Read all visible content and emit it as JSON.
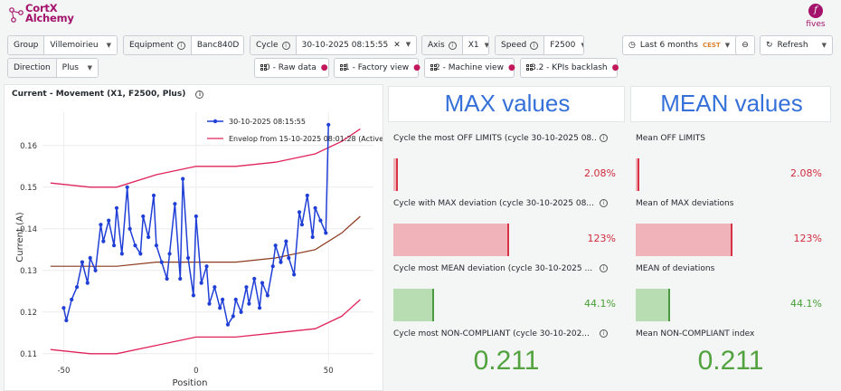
{
  "brand": {
    "line1": "CortX",
    "line2": "Alchemy",
    "right_logo": "fives"
  },
  "filters": {
    "group": {
      "label": "Group",
      "value": "Villemoirieu"
    },
    "equipment": {
      "label": "Equipment",
      "value": "Banc840D"
    },
    "cycle": {
      "label": "Cycle",
      "value": "30-10-2025 08:15:55"
    },
    "axis": {
      "label": "Axis",
      "value": "X1"
    },
    "speed": {
      "label": "Speed",
      "value": "F2500"
    },
    "direction": {
      "label": "Direction",
      "value": "Plus"
    }
  },
  "time_range": {
    "label": "Last 6 months",
    "tz": "CEST"
  },
  "refresh_label": "Refresh",
  "view_links": [
    "0 - Raw data",
    "1 - Factory view",
    "2 - Machine view",
    "3.2 - KPIs backlash"
  ],
  "chart_panel": {
    "title": "Current - Movement (X1, F2500, Plus)"
  },
  "chart_data": {
    "type": "line",
    "xlabel": "Position",
    "ylabel": "Current (A)",
    "xlim": [
      -58,
      67
    ],
    "ylim": [
      0.108,
      0.168
    ],
    "xticks": [
      -50,
      0,
      50
    ],
    "yticks": [
      0.11,
      0.12,
      0.13,
      0.14,
      0.15,
      0.16
    ],
    "legend_placement": "top-right",
    "series": [
      {
        "name": "30-10-2025 08:15:55",
        "color": "#1f3fd6",
        "style": "line+markers",
        "x": [
          -50,
          -49,
          -47,
          -45,
          -43,
          -41,
          -40,
          -38,
          -36,
          -35,
          -33,
          -31,
          -30,
          -28,
          -26,
          -25,
          -23,
          -21,
          -20,
          -18,
          -16,
          -15,
          -13,
          -11,
          -10,
          -8,
          -6,
          -5,
          -3,
          -1,
          0,
          2,
          4,
          5,
          7,
          9,
          10,
          12,
          14,
          15,
          17,
          19,
          20,
          22,
          24,
          25,
          27,
          29,
          30,
          32,
          34,
          35,
          37,
          39,
          40,
          42,
          44,
          45,
          47,
          49,
          50
        ],
        "y": [
          0.121,
          0.118,
          0.123,
          0.126,
          0.132,
          0.127,
          0.133,
          0.13,
          0.141,
          0.137,
          0.142,
          0.136,
          0.145,
          0.134,
          0.15,
          0.14,
          0.136,
          0.134,
          0.143,
          0.138,
          0.148,
          0.136,
          0.132,
          0.128,
          0.134,
          0.146,
          0.128,
          0.152,
          0.133,
          0.124,
          0.143,
          0.127,
          0.131,
          0.122,
          0.126,
          0.121,
          0.123,
          0.117,
          0.119,
          0.123,
          0.12,
          0.126,
          0.122,
          0.128,
          0.121,
          0.127,
          0.124,
          0.131,
          0.136,
          0.132,
          0.137,
          0.133,
          0.129,
          0.144,
          0.141,
          0.148,
          0.138,
          0.145,
          0.142,
          0.139,
          0.165
        ]
      },
      {
        "name": "Envelop from 15-10-2025 08:01:28 (Active)",
        "color": "#e0245a",
        "style": "line",
        "band": true,
        "x": [
          -55,
          -40,
          -30,
          -15,
          0,
          15,
          30,
          45,
          55,
          62
        ],
        "upper": [
          0.151,
          0.15,
          0.15,
          0.153,
          0.155,
          0.155,
          0.156,
          0.158,
          0.161,
          0.164
        ],
        "lower": [
          0.111,
          0.11,
          0.11,
          0.112,
          0.114,
          0.114,
          0.115,
          0.116,
          0.119,
          0.123
        ]
      },
      {
        "name": "",
        "color": "#8c3a1d",
        "style": "line",
        "x": [
          -55,
          -40,
          -30,
          -15,
          0,
          15,
          30,
          45,
          55,
          62
        ],
        "y": [
          0.131,
          0.131,
          0.131,
          0.132,
          0.132,
          0.132,
          0.133,
          0.135,
          0.139,
          0.143
        ]
      }
    ]
  },
  "max_header": "MAX values",
  "mean_header": "MEAN values",
  "max_stats": [
    {
      "title": "Cycle the most OFF LIMITS (cycle 30-10-2025 08...",
      "value": "2.08%",
      "fraction": 0.02,
      "color": "red"
    },
    {
      "title": "Cycle with MAX deviation (cycle 30-10-2025 08...",
      "value": "123%",
      "fraction": 0.51,
      "color": "red"
    },
    {
      "title": "Cycle most MEAN deviation (cycle 30-10-2025 ...",
      "value": "44.1%",
      "fraction": 0.18,
      "color": "green"
    }
  ],
  "max_big": {
    "title": "Cycle most NON-COMPLIANT (cycle 30-10-202...",
    "value": "0.211"
  },
  "mean_stats": [
    {
      "title": "Mean OFF LIMITS",
      "value": "2.08%",
      "fraction": 0.02,
      "color": "red"
    },
    {
      "title": "Mean of MAX deviations",
      "value": "123%",
      "fraction": 0.51,
      "color": "red"
    },
    {
      "title": "MEAN of deviations",
      "value": "44.1%",
      "fraction": 0.18,
      "color": "green"
    }
  ],
  "mean_big": {
    "title": "Mean NON-COMPLIANT index",
    "value": "0.211"
  }
}
